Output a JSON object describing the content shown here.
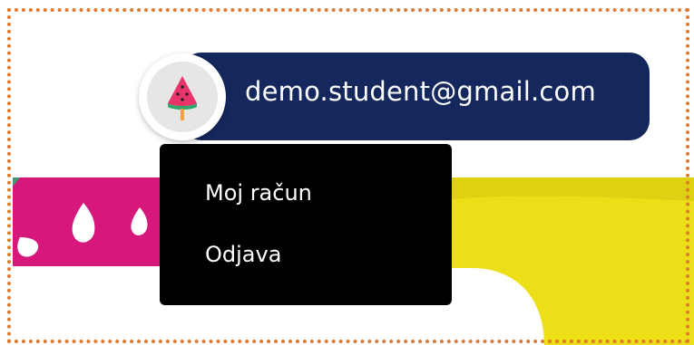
{
  "user": {
    "email": "demo.student@gmail.com",
    "avatar_icon": "watermelon-popsicle-icon"
  },
  "menu": {
    "items": [
      {
        "label": "Moj račun"
      },
      {
        "label": "Odjava"
      }
    ]
  },
  "colors": {
    "pill_background": "#15285e",
    "dropdown_background": "#000000",
    "frame_border": "#e07b2e",
    "banner_magenta": "#d6187c",
    "banner_yellow": "#ecde17",
    "banner_green": "#3f9b6a"
  }
}
